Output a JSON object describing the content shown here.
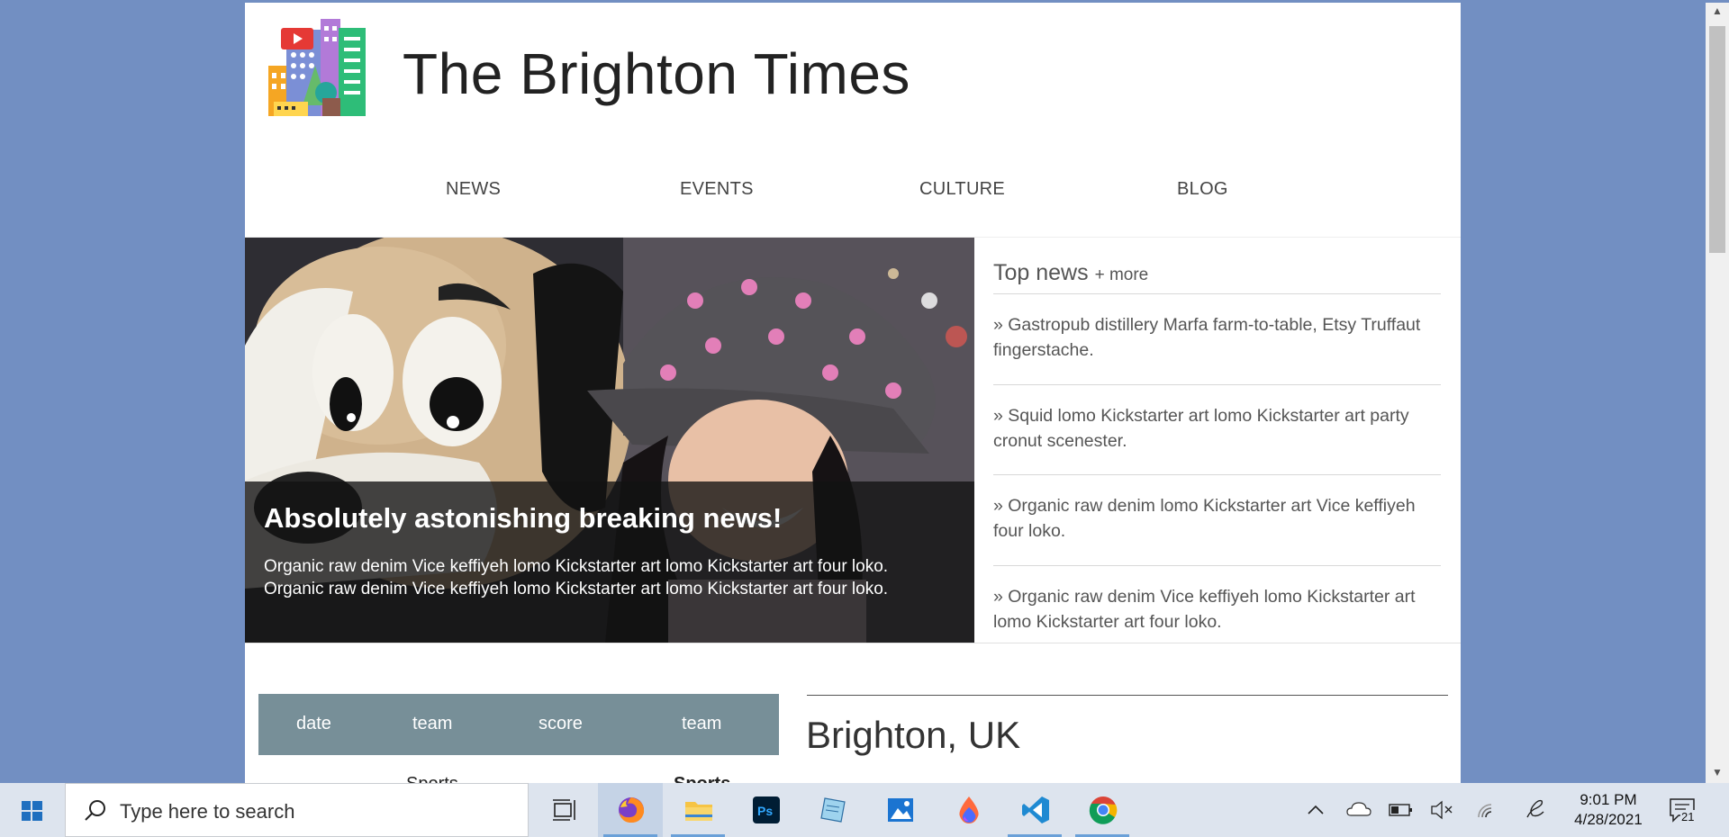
{
  "site": {
    "title": "The Brighton Times"
  },
  "nav": [
    "NEWS",
    "EVENTS",
    "CULTURE",
    "BLOG"
  ],
  "hero": {
    "headline": "Absolutely astonishing breaking news!",
    "text": "Organic raw denim Vice keffiyeh lomo Kickstarter art lomo Kickstarter art four loko. Organic raw denim Vice keffiyeh lomo Kickstarter art lomo Kickstarter art four loko."
  },
  "top_news": {
    "heading": "Top news",
    "more": "+ more",
    "items": [
      "» Gastropub distillery Marfa farm-to-table, Etsy Truffaut fingerstache.",
      "» Squid lomo Kickstarter art lomo Kickstarter art party cronut scenester.",
      "» Organic raw denim lomo Kickstarter art Vice keffiyeh four loko.",
      "» Organic raw denim Vice keffiyeh lomo Kickstarter art lomo Kickstarter art four loko."
    ]
  },
  "scores": {
    "headers": [
      "date",
      "team",
      "score",
      "team"
    ],
    "row_partial": [
      "Sports",
      "Sports"
    ]
  },
  "weather": {
    "city": "Brighton, UK"
  },
  "taskbar": {
    "search_placeholder": "Type here to search",
    "time": "9:01 PM",
    "date": "4/28/2021",
    "notification_count": "21",
    "apps": [
      "task-view",
      "firefox",
      "file-explorer",
      "photoshop",
      "notepad",
      "photos",
      "paint",
      "vscode",
      "chrome"
    ]
  },
  "colors": {
    "background": "#728fc2",
    "score_header": "#778f98",
    "taskbar": "#dde4ee"
  }
}
